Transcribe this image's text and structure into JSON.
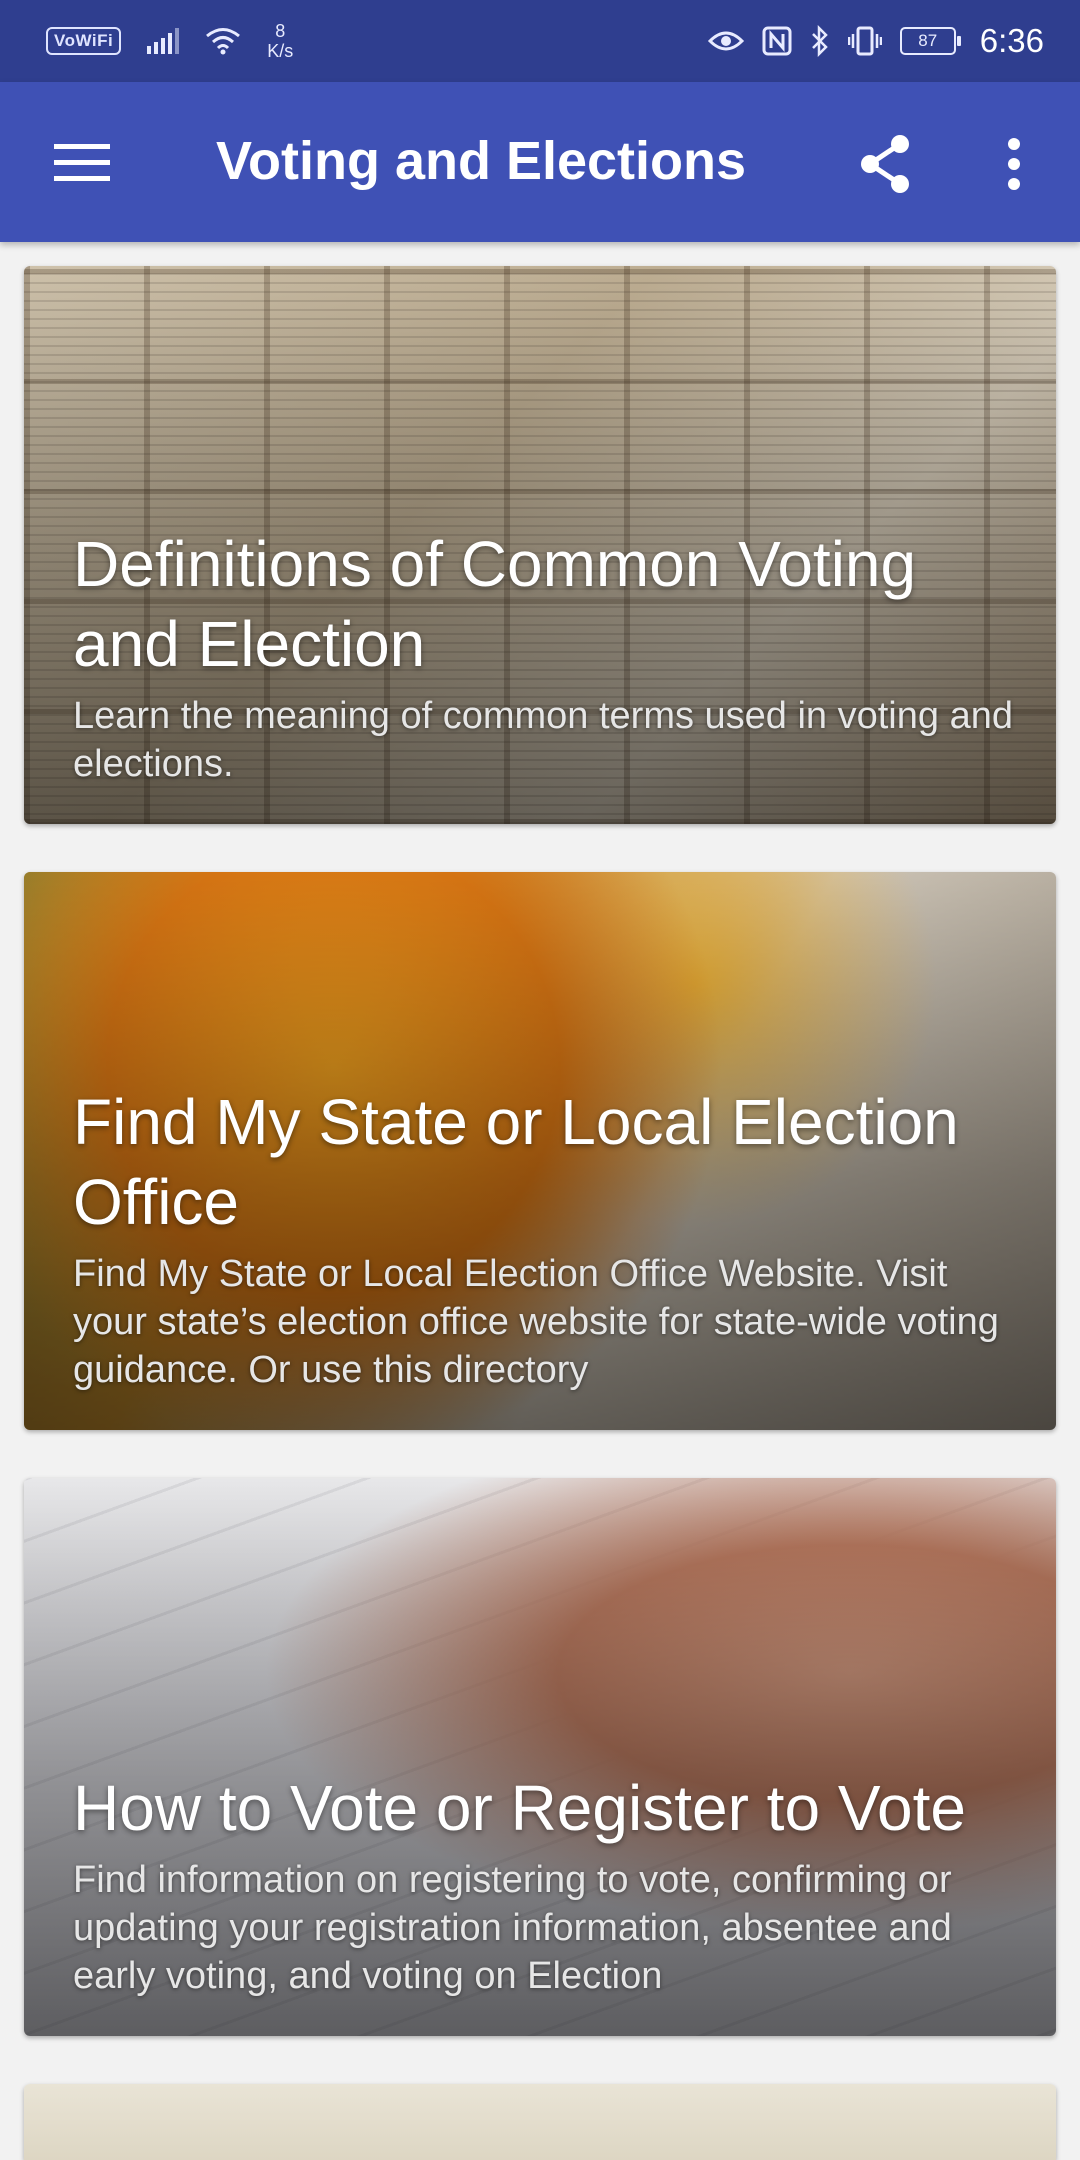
{
  "status_bar": {
    "vowifi": "VoWiFi",
    "net_speed_value": "8",
    "net_speed_unit": "K/s",
    "battery": "87",
    "time": "6:36"
  },
  "app_bar": {
    "title": "Voting and Elections",
    "menu_icon": "hamburger-menu-icon",
    "share_icon": "share-icon",
    "more_icon": "more-vert-icon"
  },
  "cards": [
    {
      "title": "Definitions of Common Voting and Election",
      "description": "Learn the meaning of common terms used in voting and elections."
    },
    {
      "title": "Find My State or Local Election Office",
      "description": "Find My State or Local Election Office Website. Visit your state’s election office website for state-wide voting guidance. Or use this directory"
    },
    {
      "title": "How to Vote or Register to Vote",
      "description": "Find information on registering to vote, confirming or updating your registration information, absentee and early voting, and voting on Election"
    }
  ],
  "colors": {
    "status_bar": "#2f3e8f",
    "app_bar": "#3f51b5",
    "background": "#f2f2f2"
  }
}
